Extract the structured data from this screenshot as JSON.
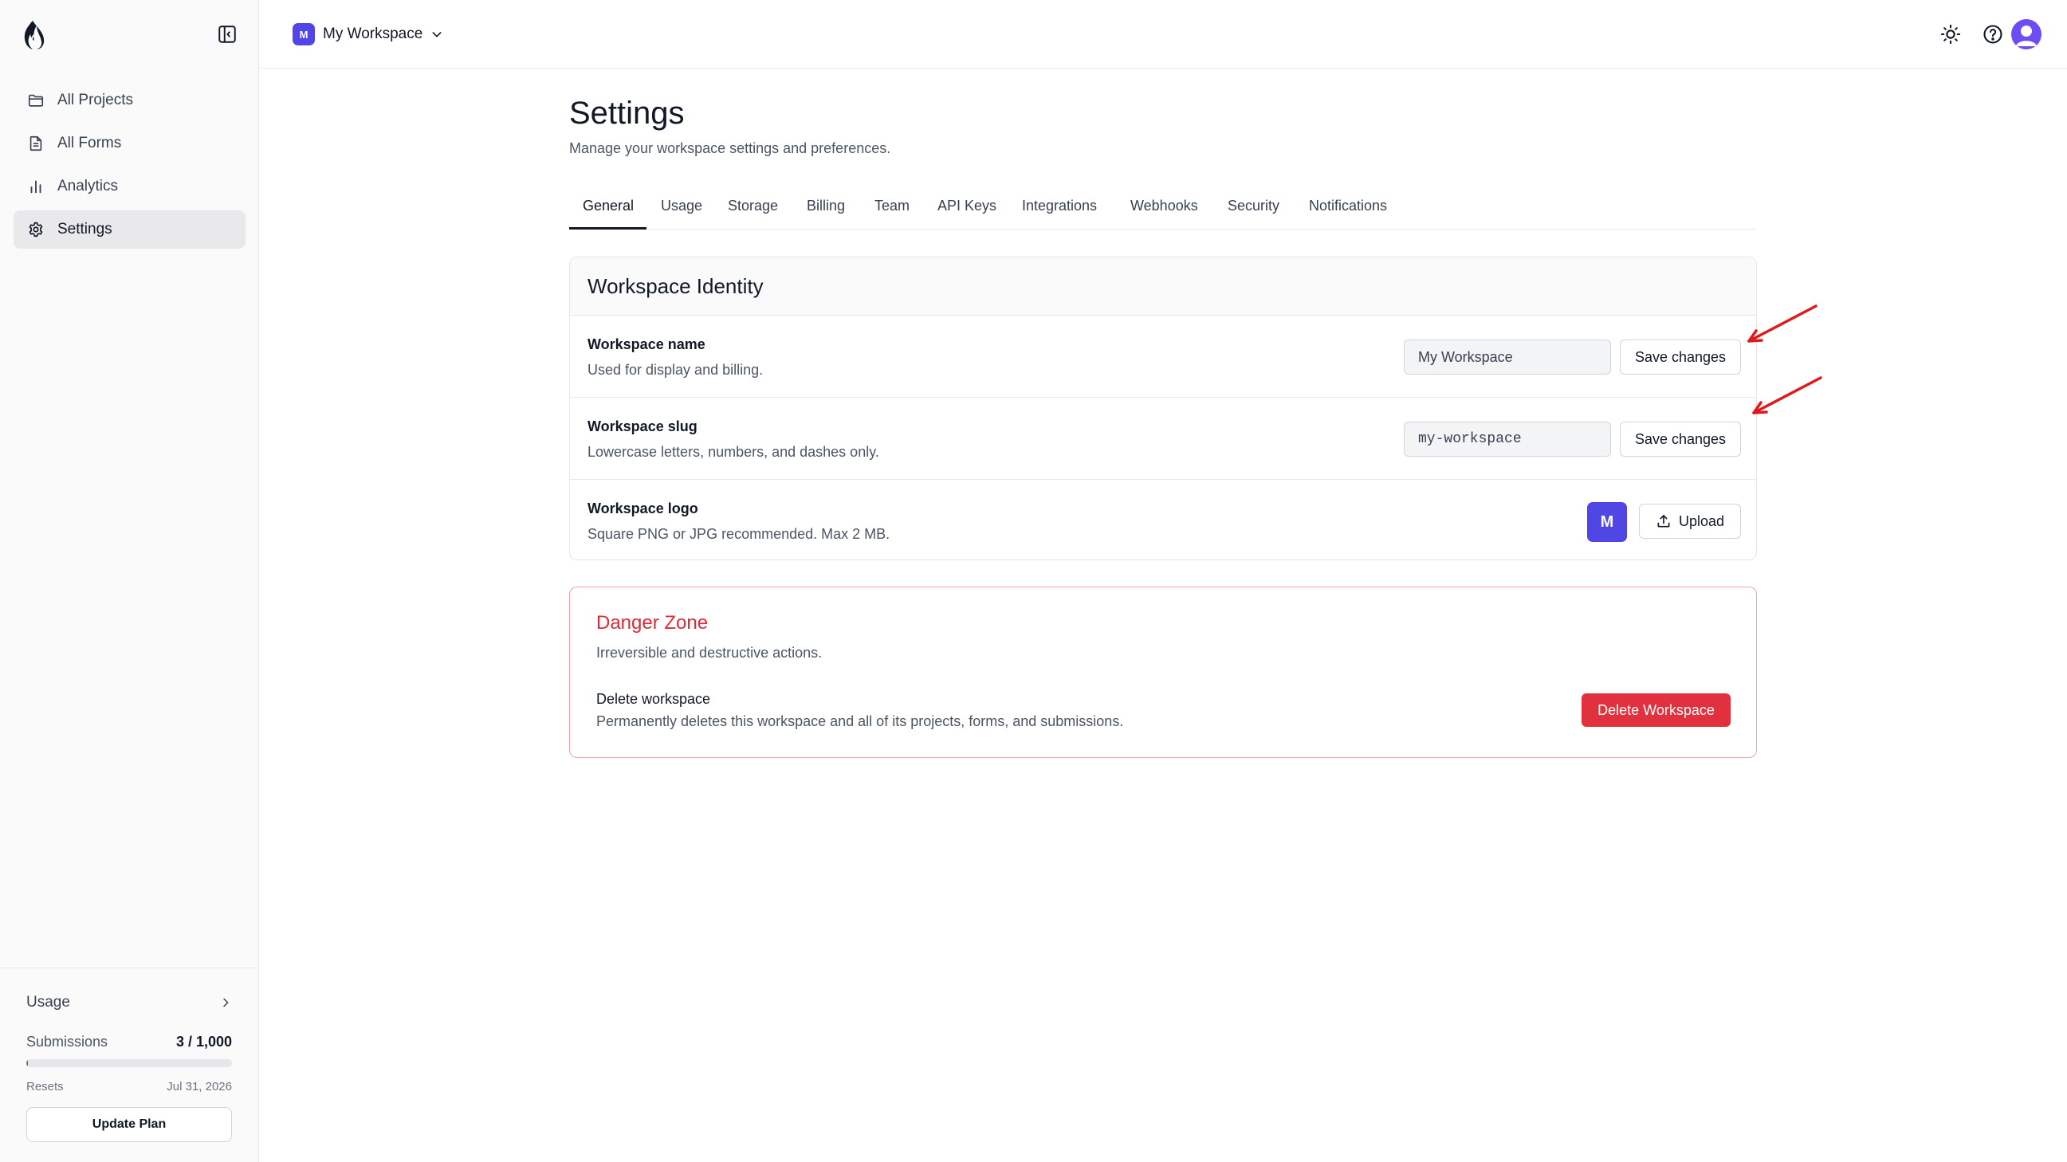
{
  "sidebar": {
    "nav": [
      {
        "label": "All Projects",
        "icon": "folder-icon"
      },
      {
        "label": "All Forms",
        "icon": "file-text-icon"
      },
      {
        "label": "Analytics",
        "icon": "bar-chart-icon"
      },
      {
        "label": "Settings",
        "icon": "gear-icon",
        "active": true
      }
    ],
    "usage": {
      "title": "Usage",
      "submissions_label": "Submissions",
      "submissions_value": "3 / 1,000",
      "submissions_fraction": 0.003,
      "resets_label": "Resets",
      "resets_date": "Jul 31, 2026",
      "update_plan": "Update Plan"
    }
  },
  "topbar": {
    "workspace_initial": "M",
    "workspace_name": "My Workspace",
    "icons": [
      "sun-icon",
      "help-circle-icon",
      "user-avatar"
    ]
  },
  "page": {
    "title": "Settings",
    "subtitle": "Manage your workspace settings and preferences."
  },
  "tabs": [
    {
      "label": "General",
      "active": true
    },
    {
      "label": "Usage"
    },
    {
      "label": "Storage"
    },
    {
      "label": "Billing"
    },
    {
      "label": "Team"
    },
    {
      "label": "API Keys"
    },
    {
      "label": "Integrations"
    },
    {
      "label": "Webhooks"
    },
    {
      "label": "Security"
    },
    {
      "label": "Notifications"
    }
  ],
  "identity": {
    "title": "Workspace Identity",
    "name": {
      "label": "Workspace name",
      "help": "Used for display and billing.",
      "value": "My Workspace",
      "button": "Save changes"
    },
    "slug": {
      "label": "Workspace slug",
      "help": "Lowercase letters, numbers, and dashes only.",
      "value": "my-workspace",
      "button": "Save changes"
    },
    "logo": {
      "label": "Workspace logo",
      "help": "Square PNG or JPG recommended. Max 2 MB.",
      "initial": "M",
      "button": "Upload"
    }
  },
  "danger": {
    "title": "Danger Zone",
    "subtitle": "Irreversible and destructive actions.",
    "delete_label": "Delete workspace",
    "delete_help": "Permanently deletes this workspace and all of its projects, forms, and submissions.",
    "delete_button": "Delete Workspace"
  },
  "colors": {
    "accent": "#4f46e5",
    "danger": "#e2313e",
    "annotation_arrow": "#e0191b"
  }
}
